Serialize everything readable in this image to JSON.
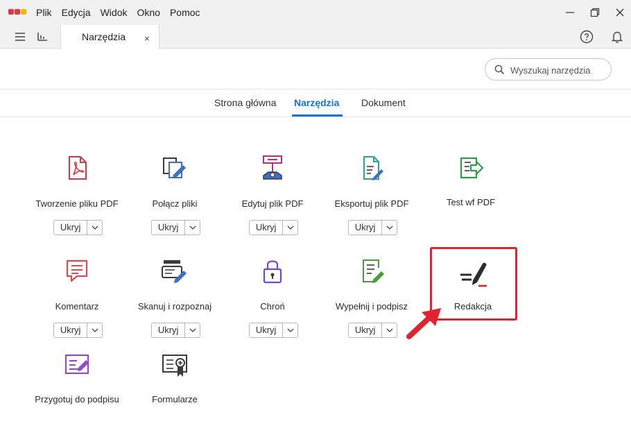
{
  "menubar": {
    "items": [
      "Plik",
      "Edycja",
      "Widok",
      "Okno",
      "Pomoc"
    ]
  },
  "window": {
    "minimize_icon": "minimize-icon",
    "restore_icon": "restore-icon",
    "close_icon": "close-icon"
  },
  "tabbar": {
    "tab_label": "Narzędzia",
    "tab_close": "×"
  },
  "search": {
    "placeholder": "Wyszukaj narzędzia"
  },
  "nav": {
    "home": "Strona główna",
    "tools": "Narzędzia",
    "document": "Dokument"
  },
  "tools": [
    {
      "label": "Tworzenie pliku PDF",
      "select": "Ukryj",
      "icon": "create-pdf-icon"
    },
    {
      "label": "Połącz pliki",
      "select": "Ukryj",
      "icon": "combine-files-icon"
    },
    {
      "label": "Edytuj plik PDF",
      "select": "Ukryj",
      "icon": "edit-pdf-icon"
    },
    {
      "label": "Eksportuj plik PDF",
      "select": "Ukryj",
      "icon": "export-pdf-icon"
    },
    {
      "label": "Test wf PDF",
      "icon": "test-pdf-icon"
    },
    {
      "label": "Komentarz",
      "select": "Ukryj",
      "icon": "comment-icon"
    },
    {
      "label": "Skanuj i rozpoznaj",
      "select": "Ukryj",
      "icon": "scan-ocr-icon"
    },
    {
      "label": "Chroń",
      "select": "Ukryj",
      "icon": "protect-lock-icon"
    },
    {
      "label": "Wypełnij i podpisz",
      "select": "Ukryj",
      "icon": "fill-sign-icon"
    },
    {
      "label": "Redakcja",
      "icon": "redact-icon"
    },
    {
      "label": "Przygotuj do podpisu",
      "icon": "prepare-signature-icon"
    },
    {
      "label": "Formularze",
      "icon": "forms-icon"
    }
  ],
  "colors": {
    "accent": "#1473e6",
    "highlight": "#e3232c",
    "pdf_red": "#d9363e",
    "combine_blue": "#3d6fc8",
    "edit_pink": "#b6327c",
    "export_teal": "#2aa39a",
    "test_green": "#2e9a4d",
    "comment_red": "#e34850",
    "scan_blue": "#3d6fc8",
    "protect_purple": "#6d4ac8",
    "fill_green": "#4a9b3a",
    "prepare_purple": "#8f4ad0"
  }
}
